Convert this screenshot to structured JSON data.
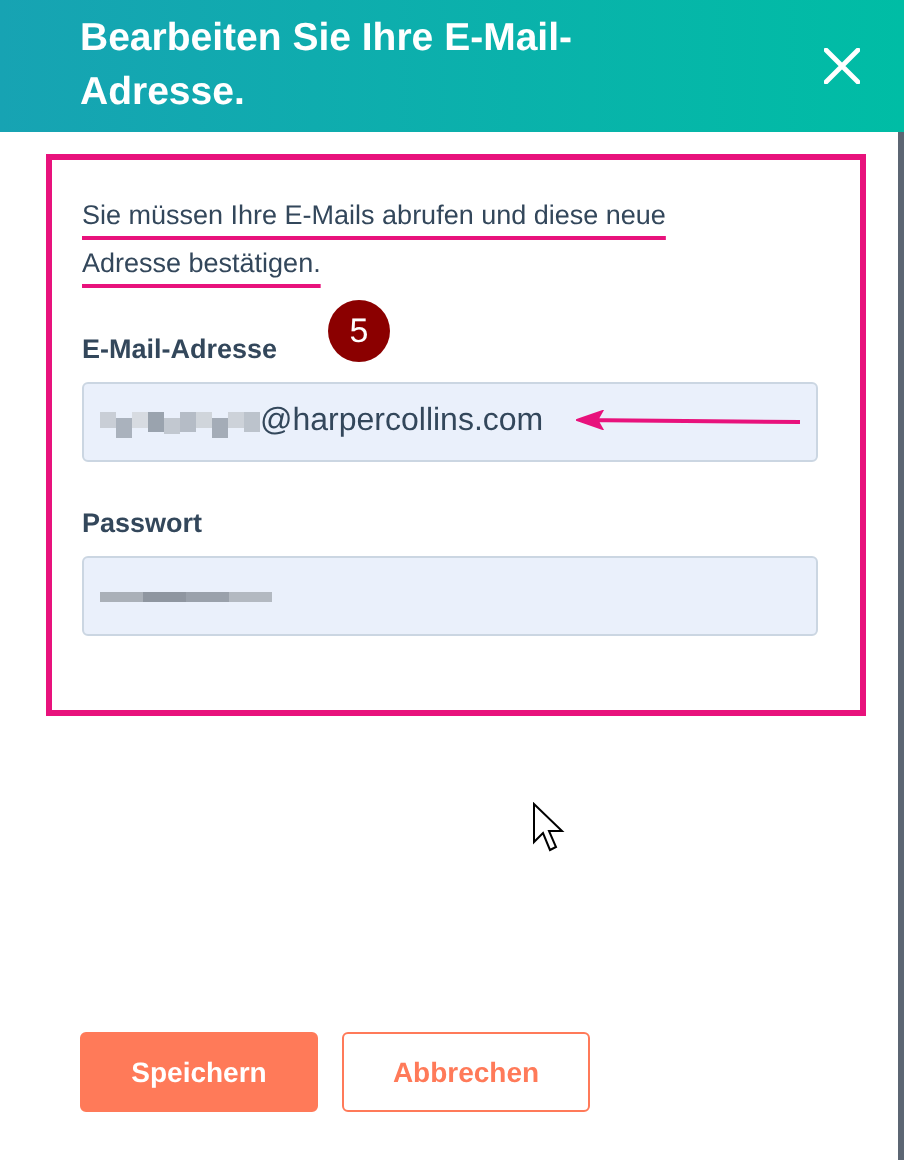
{
  "dialog": {
    "title": "Bearbeiten Sie Ihre E-Mail-Adresse.",
    "notice": "Sie müssen Ihre E-Mails abrufen und diese neue Adresse bestätigen.",
    "fields": [
      {
        "label": "E-Mail-Adresse",
        "value": "@harpercollins.com",
        "redacted": true
      },
      {
        "label": "Passwort",
        "redacted": true
      }
    ],
    "buttons": [
      {
        "label": "Speichern",
        "kind": "primary"
      },
      {
        "label": "Abbrechen",
        "kind": "secondary"
      }
    ]
  },
  "annotations": {
    "step_badge": "5"
  }
}
